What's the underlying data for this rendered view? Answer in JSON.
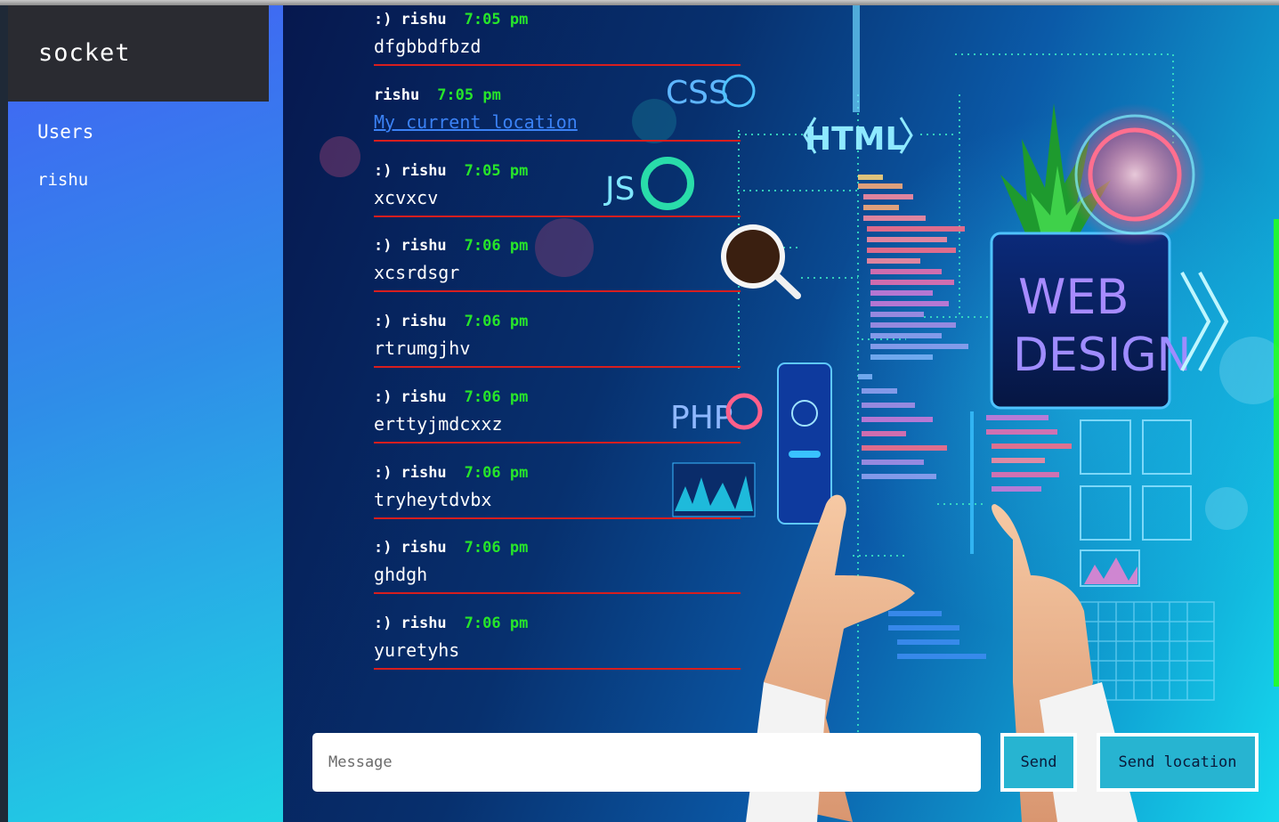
{
  "sidebar": {
    "brand": "socket",
    "users_title": "Users",
    "users": [
      "rishu"
    ]
  },
  "messages": [
    {
      "prefix": ":)",
      "name": "rishu",
      "time": "7:05 pm",
      "text": "dfgbbdfbzd"
    },
    {
      "prefix": "",
      "name": "rishu",
      "time": "7:05 pm",
      "link_text": "My current location"
    },
    {
      "prefix": ":)",
      "name": "rishu",
      "time": "7:05 pm",
      "text": "xcvxcv"
    },
    {
      "prefix": ":)",
      "name": "rishu",
      "time": "7:06 pm",
      "text": "xcsrdsgr"
    },
    {
      "prefix": ":)",
      "name": "rishu",
      "time": "7:06 pm",
      "text": "rtrumgjhv"
    },
    {
      "prefix": ":)",
      "name": "rishu",
      "time": "7:06 pm",
      "text": "erttyjmdcxxz"
    },
    {
      "prefix": ":)",
      "name": "rishu",
      "time": "7:06 pm",
      "text": "tryheytdvbx"
    },
    {
      "prefix": ":)",
      "name": "rishu",
      "time": "7:06 pm",
      "text": "ghdgh"
    },
    {
      "prefix": ":)",
      "name": "rishu",
      "time": "7:06 pm",
      "text": "yuretyhs"
    }
  ],
  "composer": {
    "placeholder": "Message",
    "send_label": "Send",
    "location_label": "Send location"
  },
  "background_art": {
    "css": "CSS",
    "html": "HTML",
    "js": "JS",
    "php": "PHP",
    "web": "WEB",
    "design": "DESIGN"
  },
  "colors": {
    "sidebar_top": "#4361f5",
    "sidebar_bottom": "#1fd3e3",
    "brand_bg": "#2a2b31",
    "time": "#27e52a",
    "divider": "#d81e1e",
    "link": "#3b82f6",
    "button": "#27b4d1"
  }
}
